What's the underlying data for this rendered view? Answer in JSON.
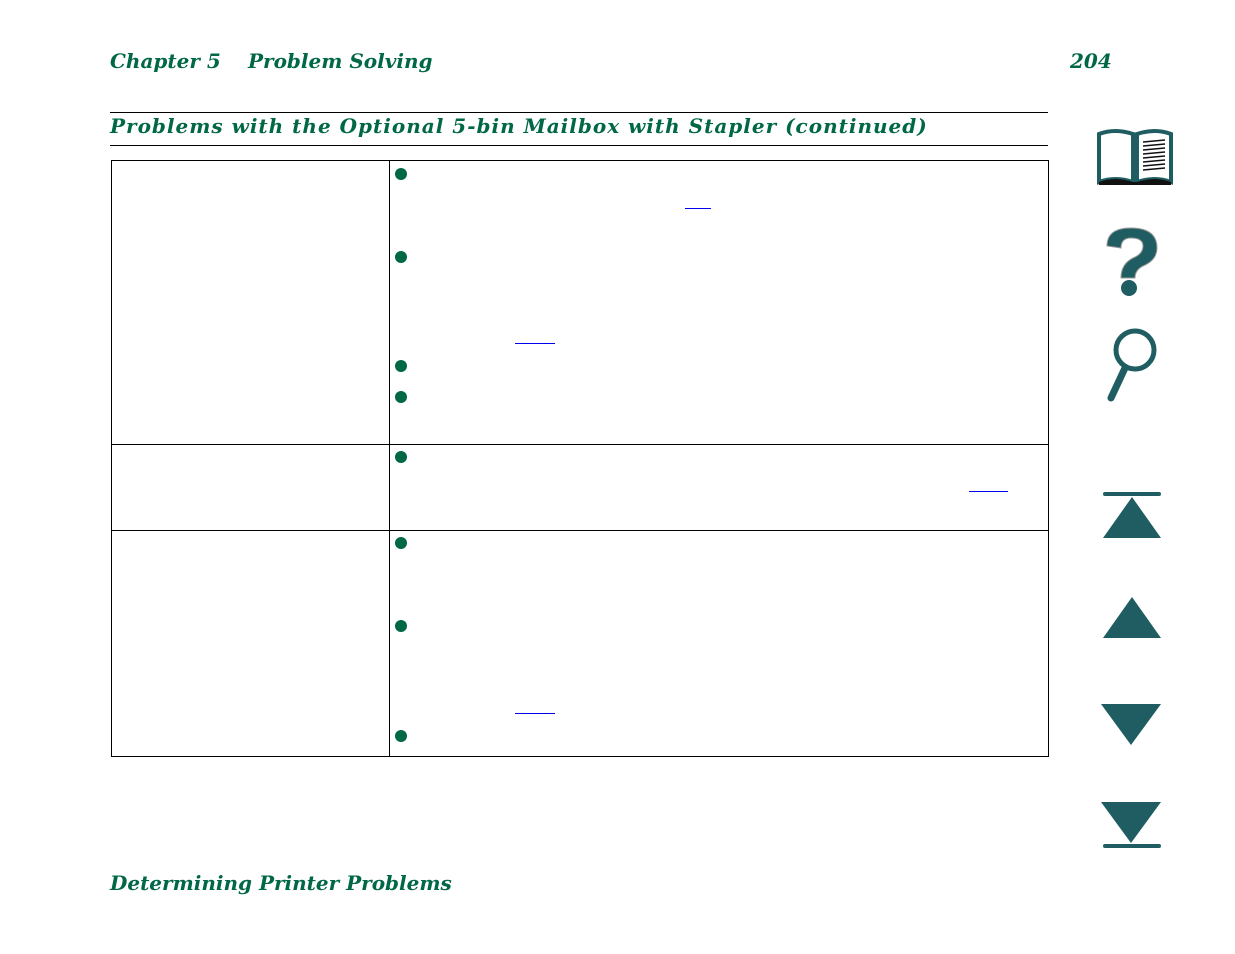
{
  "header": {
    "chapter": "Chapter 5",
    "chapter_title": "Problem Solving",
    "page_number": "204"
  },
  "section_title": "Problems with the Optional 5-bin Mailbox with Stapler (continued)",
  "table": {
    "rows": [
      {
        "problem": "",
        "bullets": 4,
        "links": 2
      },
      {
        "problem": "",
        "bullets": 1,
        "links": 1
      },
      {
        "problem": "",
        "bullets": 3,
        "links": 1
      }
    ]
  },
  "footer": "Determining Printer Problems",
  "nav": {
    "contents": "book-icon",
    "help": "question-icon",
    "search": "magnifier-icon",
    "first_page": "first-page-icon",
    "previous_page": "previous-page-icon",
    "next_page": "next-page-icon",
    "last_page": "last-page-icon"
  },
  "colors": {
    "accent": "#006747",
    "icon": "#1f5d62",
    "link": "#0000ee"
  }
}
